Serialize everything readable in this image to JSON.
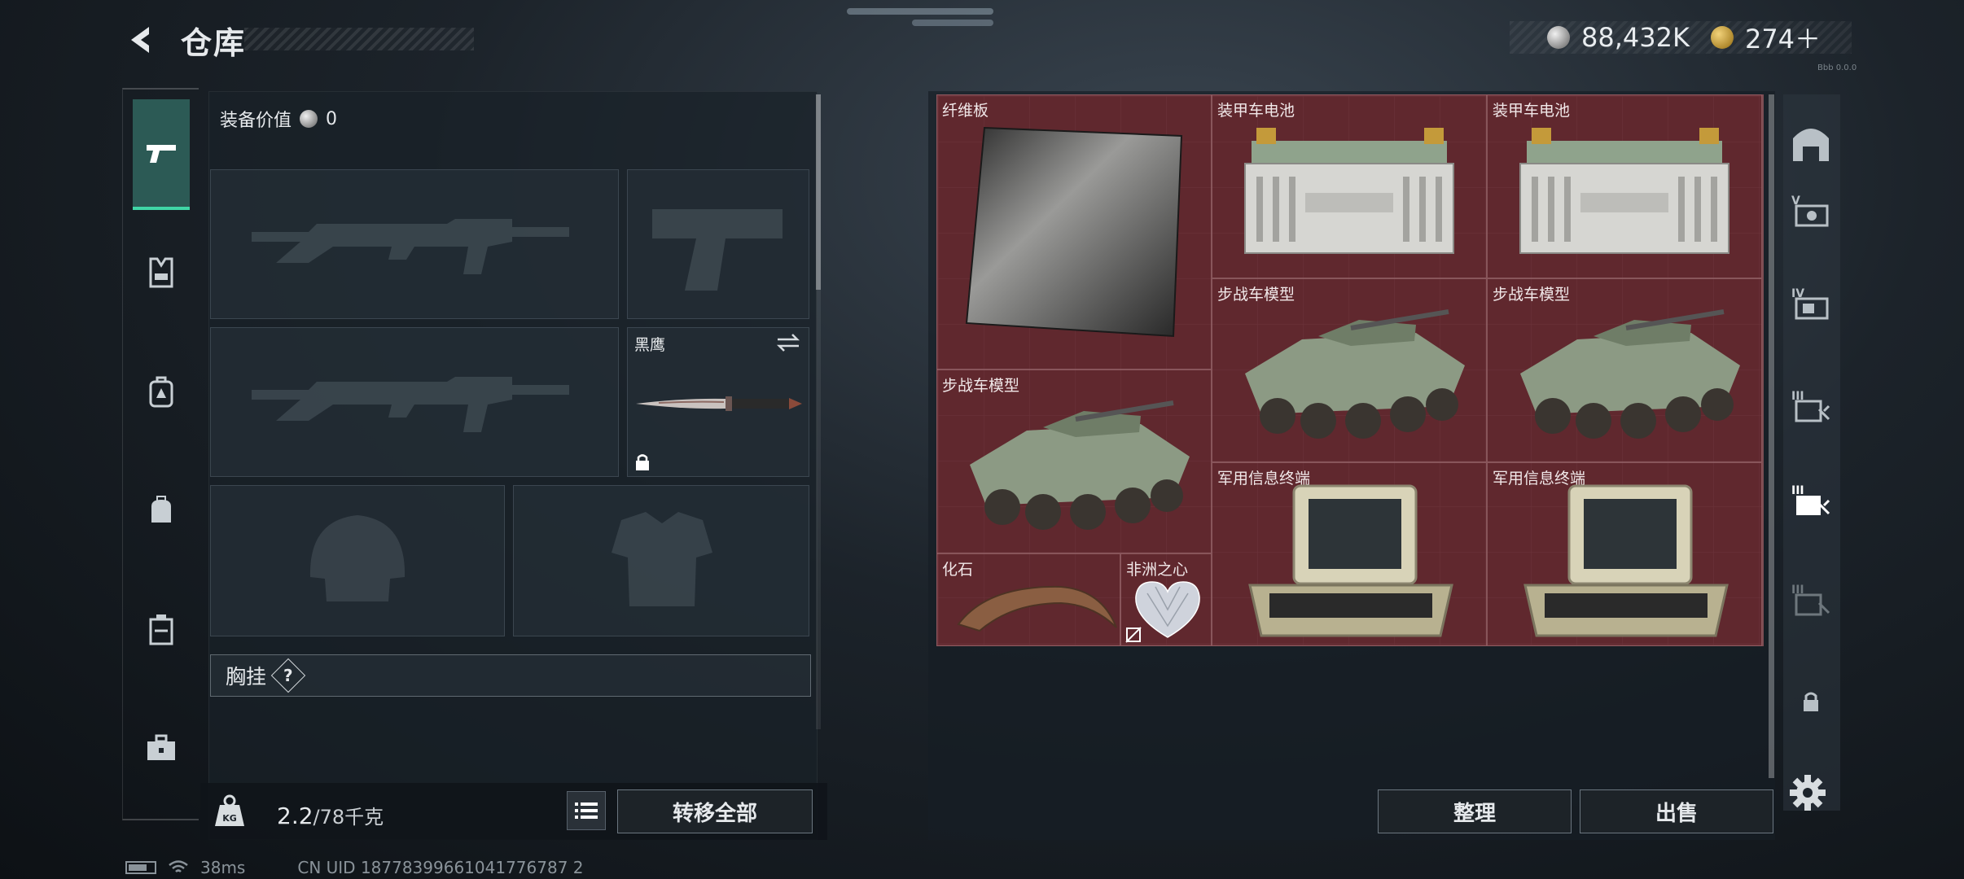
{
  "header": {
    "title": "仓库",
    "silver_amount": "88,432K",
    "gold_amount": "274＋",
    "version": "Bbb 0.0.0"
  },
  "equipment": {
    "value_label": "装备价值",
    "value": "0",
    "knife_name": "黑鹰",
    "chest_label": "胸挂",
    "chest_help": "?"
  },
  "footer": {
    "weight_current": "2.2",
    "weight_max": "/78千克",
    "weight_badge": "KG",
    "transfer_all": "转移全部",
    "sort": "整理",
    "sell": "出售"
  },
  "stash_items": [
    {
      "name": "纤维板"
    },
    {
      "name": "装甲车电池"
    },
    {
      "name": "装甲车电池"
    },
    {
      "name": "步战车模型"
    },
    {
      "name": "步战车模型"
    },
    {
      "name": "步战车模型"
    },
    {
      "name": "军用信息终端"
    },
    {
      "name": "军用信息终端"
    },
    {
      "name": "化石"
    },
    {
      "name": "非洲之心"
    }
  ],
  "status": {
    "ping": "38ms",
    "uid": "CN UID 18778399661041776787 2"
  },
  "colors": {
    "accent": "#40d6a6",
    "grid_bg": "#5e2a30",
    "panel": "#192128"
  }
}
